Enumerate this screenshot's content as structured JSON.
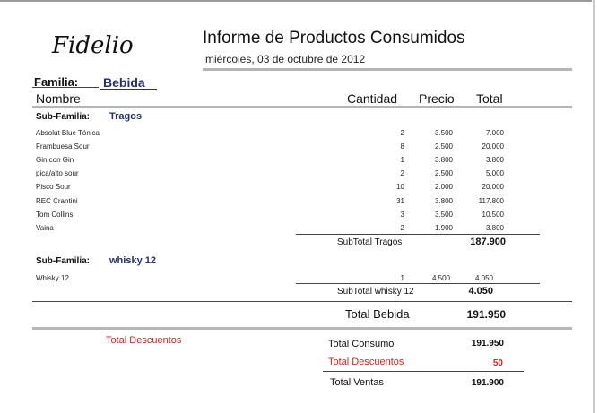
{
  "header": {
    "logo": "Fidelio",
    "title": "Informe de Productos Consumidos",
    "date": "miércoles, 03 de octubre de 2012"
  },
  "familia": {
    "label": "Familia:",
    "value": "Bebida"
  },
  "columns": {
    "nombre": "Nombre",
    "cantidad": "Cantidad",
    "precio": "Precio",
    "total": "Total"
  },
  "groups": [
    {
      "label": "Sub-Familia:",
      "name": "Tragos",
      "rows": [
        {
          "name": "Absolut Blue Tónica",
          "cantidad": "2",
          "precio": "3.500",
          "total": "7.000"
        },
        {
          "name": "Frambuesa Sour",
          "cantidad": "8",
          "precio": "2.500",
          "total": "20.000"
        },
        {
          "name": "Gin con Gin",
          "cantidad": "1",
          "precio": "3.800",
          "total": "3.800"
        },
        {
          "name": "pica/alto sour",
          "cantidad": "2",
          "precio": "2.500",
          "total": "5.000"
        },
        {
          "name": "Pisco Sour",
          "cantidad": "10",
          "precio": "2.000",
          "total": "20.000"
        },
        {
          "name": "REC Crantini",
          "cantidad": "31",
          "precio": "3.800",
          "total": "117.800"
        },
        {
          "name": "Tom Collins",
          "cantidad": "3",
          "precio": "3.500",
          "total": "10.500"
        },
        {
          "name": "Vaina",
          "cantidad": "2",
          "precio": "1.900",
          "total": "3.800"
        }
      ],
      "subtotal_label": "SubTotal  Tragos",
      "subtotal_value": "187.900"
    },
    {
      "label": "Sub-Familia:",
      "name": "whisky 12",
      "rows": [
        {
          "name": "Whisky 12",
          "cantidad": "1",
          "precio": "4.500",
          "total": "4.050"
        }
      ],
      "subtotal_label": "SubTotal  whisky 12",
      "subtotal_value": "4.050"
    }
  ],
  "familia_total": {
    "label": "Total  Bebida",
    "value": "191.950"
  },
  "descuentos_label": "Total Descuentos",
  "summary": {
    "consumo_label": "Total Consumo",
    "consumo_value": "191.950",
    "descuentos_label": "Total Descuentos",
    "descuentos_value": "50",
    "ventas_label": "Total Ventas",
    "ventas_value": "191.900"
  },
  "colors": {
    "accent_blue": "#27306d",
    "discount_red": "#d8221d",
    "rule_gray": "#b5b5b5"
  }
}
